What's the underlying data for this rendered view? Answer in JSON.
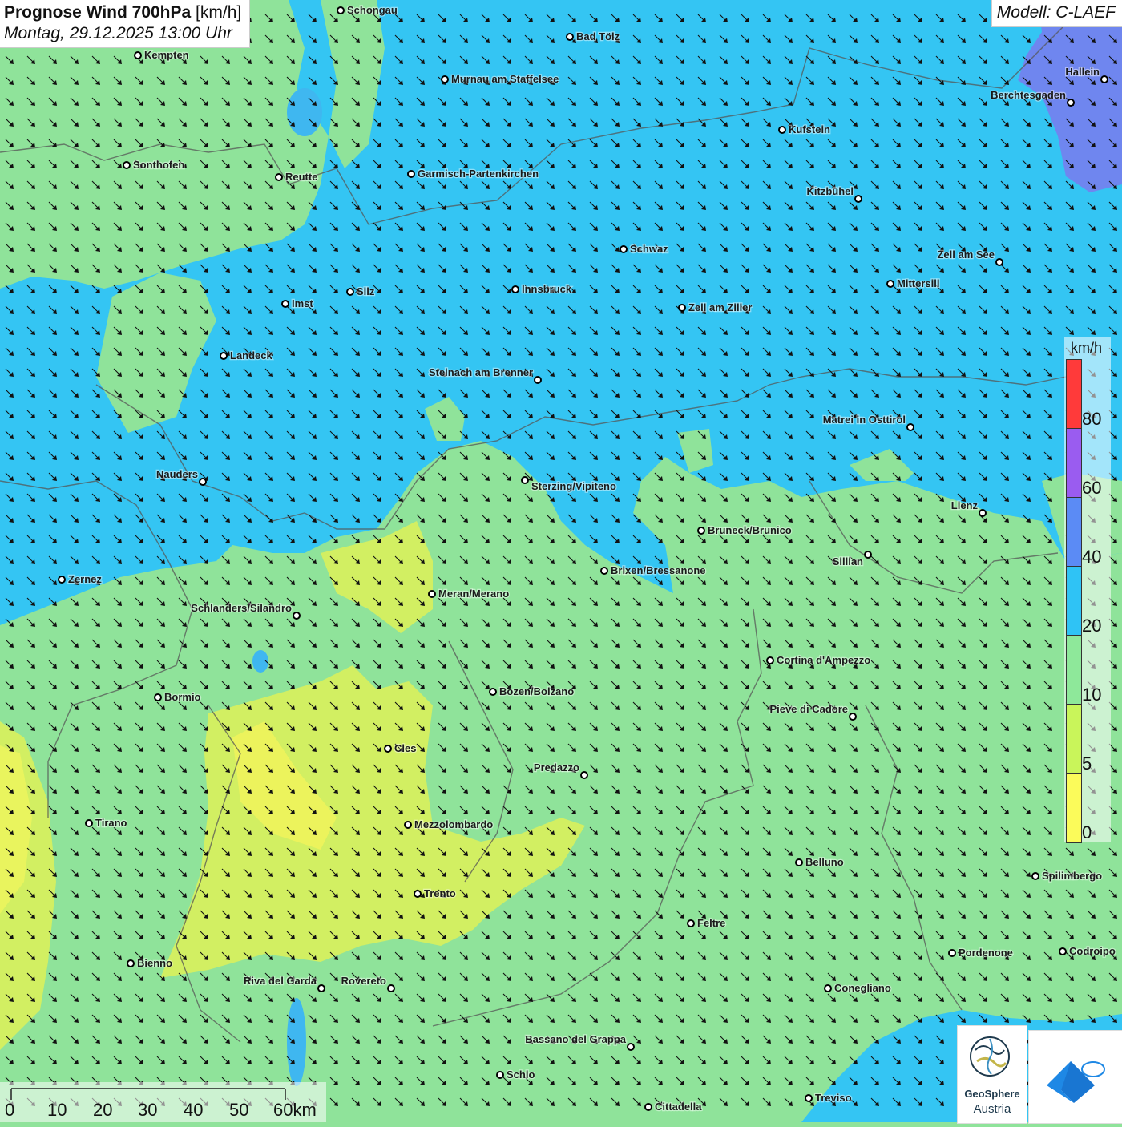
{
  "header": {
    "title_bold": "Prognose Wind 700hPa",
    "title_unit": "[km/h]",
    "datetime": "Montag, 29.12.2025 13:00 Uhr"
  },
  "model": "Modell: C-LAEF",
  "legend": {
    "unit": "km/h",
    "labels": [
      "80",
      "60",
      "40",
      "20",
      "10",
      "5",
      "0"
    ],
    "colors": [
      "#ff3a3a",
      "#9a5cf0",
      "#5b8bf5",
      "#2fc3f5",
      "#8ee89a",
      "#c9f55a",
      "#fbfb5a"
    ]
  },
  "scalebar": {
    "labels": [
      "0",
      "10",
      "20",
      "30",
      "40",
      "50",
      "60km"
    ]
  },
  "logo": {
    "name_line1": "GeoSphere",
    "name_line2": "Austria"
  },
  "wind_direction": "northwest",
  "cities": [
    {
      "name": "Schongau"
    },
    {
      "name": "Bad Tölz"
    },
    {
      "name": "Kempten"
    },
    {
      "name": "Murnau am Staffelsee"
    },
    {
      "name": "Hallein"
    },
    {
      "name": "Berchtesgaden"
    },
    {
      "name": "Kufstein"
    },
    {
      "name": "Sonthofen"
    },
    {
      "name": "Reutte"
    },
    {
      "name": "Garmisch-Partenkirchen"
    },
    {
      "name": "Kitzbühel"
    },
    {
      "name": "Schwaz"
    },
    {
      "name": "Zell am See"
    },
    {
      "name": "Mittersill"
    },
    {
      "name": "Innsbruck"
    },
    {
      "name": "Silz"
    },
    {
      "name": "Imst"
    },
    {
      "name": "Zell am Ziller"
    },
    {
      "name": "Landeck"
    },
    {
      "name": "Steinach am Brenner"
    },
    {
      "name": "Matrei in Osttirol"
    },
    {
      "name": "Nauders"
    },
    {
      "name": "Sterzing/Vipiteno"
    },
    {
      "name": "Lienz"
    },
    {
      "name": "Bruneck/Brunico"
    },
    {
      "name": "Sillian"
    },
    {
      "name": "Zernez"
    },
    {
      "name": "Brixen/Bressanone"
    },
    {
      "name": "Meran/Merano"
    },
    {
      "name": "Schlanders/Silandro"
    },
    {
      "name": "Cortina d'Ampezzo"
    },
    {
      "name": "Bozen/Bolzano"
    },
    {
      "name": "Bormio"
    },
    {
      "name": "Pieve di Cadore"
    },
    {
      "name": "Cles"
    },
    {
      "name": "Predazzo"
    },
    {
      "name": "Tirano"
    },
    {
      "name": "Mezzolombardo"
    },
    {
      "name": "Belluno"
    },
    {
      "name": "Spilimbergo"
    },
    {
      "name": "Trento"
    },
    {
      "name": "Feltre"
    },
    {
      "name": "Pordenone"
    },
    {
      "name": "Codroipo"
    },
    {
      "name": "Bienno"
    },
    {
      "name": "Riva del Garda"
    },
    {
      "name": "Rovereto"
    },
    {
      "name": "Conegliano"
    },
    {
      "name": "Bassano del Grappa"
    },
    {
      "name": "Schio"
    },
    {
      "name": "Treviso"
    },
    {
      "name": "Cittadella"
    }
  ]
}
